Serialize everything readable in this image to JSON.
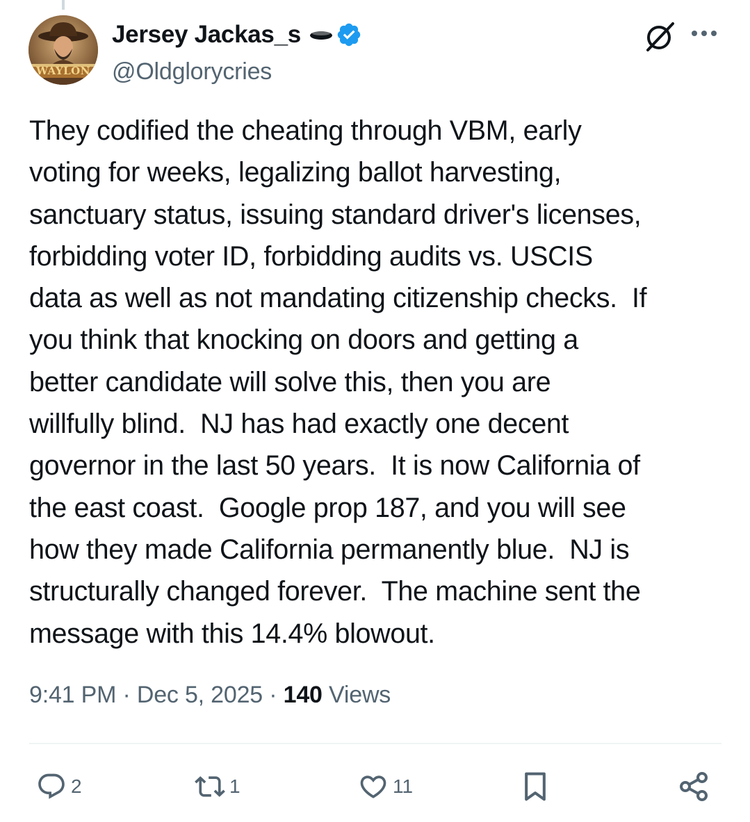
{
  "author": {
    "display_name": "Jersey Jackas_s",
    "handle": "@Oldglorycries",
    "verified": true,
    "avatar_text": "WAYLON"
  },
  "tweet": {
    "text": "They codified the cheating through VBM, early\nvoting for weeks, legalizing ballot harvesting,\nsanctuary status, issuing standard driver's licenses,\nforbidding voter ID, forbidding audits vs. USCIS\ndata as well as not mandating citizenship checks.  If\nyou think that knocking on doors and getting a\nbetter candidate will solve this, then you are\nwillfully blind.  NJ has had exactly one decent\ngovernor in the last 50 years.  It is now California of\nthe east coast.  Google prop 187, and you will see\nhow they made California permanently blue.  NJ is\nstructurally changed forever.  The machine sent the\nmessage with this 14.4% blowout."
  },
  "meta": {
    "time": "9:41 PM",
    "separator": "·",
    "date": "Dec 5, 2025",
    "views_count": "140",
    "views_label": "Views"
  },
  "actions": {
    "replies": "2",
    "reposts": "1",
    "likes": "11"
  },
  "icons": {
    "disc": "flying-saucer-icon",
    "verified": "verified-badge-icon",
    "grok": "grok-icon",
    "more": "more-icon",
    "reply": "reply-icon",
    "repost": "repost-icon",
    "like": "heart-icon",
    "bookmark": "bookmark-icon",
    "share": "share-icon"
  },
  "colors": {
    "text": "#0f1419",
    "secondary": "#536471",
    "verified": "#1d9bf0",
    "divider": "#eff3f4"
  }
}
